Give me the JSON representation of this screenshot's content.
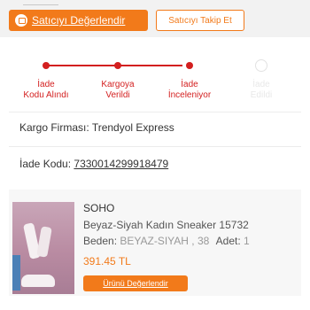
{
  "header": {
    "rate_seller_label": "Satıcıyı Değerlendir",
    "follow_seller_label": "Satıcıyı Takip Et"
  },
  "progress": {
    "steps": [
      {
        "label_line1": "İade",
        "label_line2": "Kodu Alındı",
        "state": "done"
      },
      {
        "label_line1": "Kargoya",
        "label_line2": "Verildi",
        "state": "done"
      },
      {
        "label_line1": "İade",
        "label_line2": "İnceleniyor",
        "state": "current"
      },
      {
        "label_line1": "İade",
        "label_line2": "Edildi",
        "state": "pending"
      }
    ]
  },
  "shipping": {
    "carrier_label": "Kargo Firması:",
    "carrier_value": "Trendyol Express"
  },
  "return_code": {
    "label": "İade Kodu:",
    "value": "7330014299918479"
  },
  "product": {
    "brand": "SOHO",
    "name": "Beyaz-Siyah Kadın Sneaker 15732",
    "variant_label": "Beden:",
    "variant_value": "BEYAZ-SIYAH , 38",
    "quantity_label": "Adet:",
    "quantity_value": "1",
    "price": "391.45 TL",
    "rate_product_label": "Ürünü Değerlendir"
  },
  "colors": {
    "accent": "#f27a1a",
    "progress_active": "#d31f1f",
    "progress_inactive": "#e2e2e2"
  }
}
